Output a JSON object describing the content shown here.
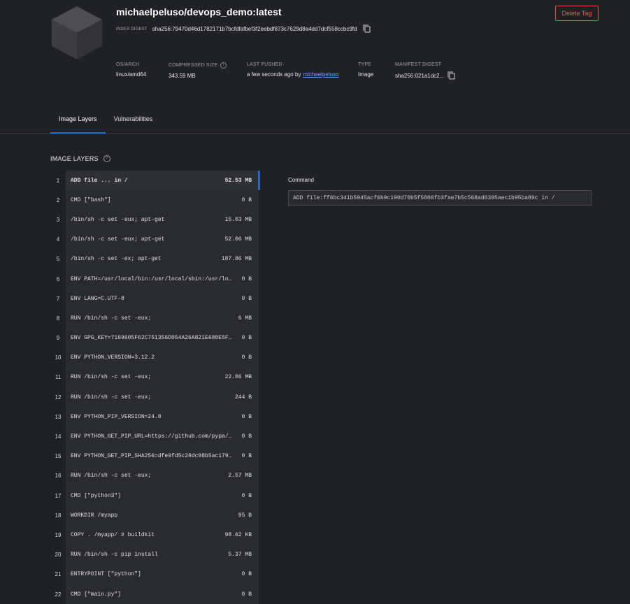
{
  "header": {
    "title": "michaelpeluso/devops_demo:latest",
    "index_digest_label": "INDEX DIGEST",
    "index_digest": "sha256:79470d46d1782171b7bcfdfafbef3f2eebdf873c7629d8a4dd7dcf558ccbc9fd",
    "delete_label": "Delete Tag"
  },
  "meta": {
    "os_arch_label": "OS/ARCH",
    "os_arch": "linux/amd64",
    "compressed_label": "COMPRESSED SIZE",
    "compressed": "343.59 MB",
    "pushed_label": "LAST PUSHED",
    "pushed_prefix": "a few seconds ago by",
    "pushed_user": "michaelpeluso",
    "type_label": "TYPE",
    "type": "Image",
    "manifest_label": "MANIFEST DIGEST",
    "manifest": "sha256:021a1dc2..."
  },
  "tabs": [
    {
      "label": "Image Layers",
      "active": true
    },
    {
      "label": "Vulnerabilities",
      "active": false
    }
  ],
  "section_title": "IMAGE LAYERS",
  "layers": [
    {
      "num": "1",
      "cmd": "ADD file ... in /",
      "size": "52.53 MB"
    },
    {
      "num": "2",
      "cmd": "CMD [\"bash\"]",
      "size": "0 B"
    },
    {
      "num": "3",
      "cmd": "/bin/sh -c set -eux; apt-get",
      "size": "15.03 MB"
    },
    {
      "num": "4",
      "cmd": "/bin/sh -c set -eux; apt-get",
      "size": "52.06 MB"
    },
    {
      "num": "5",
      "cmd": "/bin/sh -c set -ex; apt-get",
      "size": "187.86 MB"
    },
    {
      "num": "6",
      "cmd": "ENV PATH=/usr/local/bin:/usr/local/sbin:/usr/local/...",
      "size": "0 B"
    },
    {
      "num": "7",
      "cmd": "ENV LANG=C.UTF-8",
      "size": "0 B"
    },
    {
      "num": "8",
      "cmd": "RUN /bin/sh -c set -eux;",
      "size": "6 MB"
    },
    {
      "num": "9",
      "cmd": "ENV GPG_KEY=7169605F62C751356D054A26A821E680E5FA6305",
      "size": "0 B"
    },
    {
      "num": "10",
      "cmd": "ENV PYTHON_VERSION=3.12.2",
      "size": "0 B"
    },
    {
      "num": "11",
      "cmd": "RUN /bin/sh -c set -eux;",
      "size": "22.06 MB"
    },
    {
      "num": "12",
      "cmd": "RUN /bin/sh -c set -eux;",
      "size": "244 B"
    },
    {
      "num": "13",
      "cmd": "ENV PYTHON_PIP_VERSION=24.0",
      "size": "0 B"
    },
    {
      "num": "14",
      "cmd": "ENV PYTHON_GET_PIP_URL=https://github.com/pypa/get-...",
      "size": "0 B"
    },
    {
      "num": "15",
      "cmd": "ENV PYTHON_GET_PIP_SHA256=dfe9fd5c28dc98b5ac17979a9...",
      "size": "0 B"
    },
    {
      "num": "16",
      "cmd": "RUN /bin/sh -c set -eux;",
      "size": "2.57 MB"
    },
    {
      "num": "17",
      "cmd": "CMD [\"python3\"]",
      "size": "0 B"
    },
    {
      "num": "18",
      "cmd": "WORKDIR /myapp",
      "size": "95 B"
    },
    {
      "num": "19",
      "cmd": "COPY . /myapp/ # buildkit",
      "size": "98.62 KB"
    },
    {
      "num": "20",
      "cmd": "RUN /bin/sh -c pip install",
      "size": "5.37 MB"
    },
    {
      "num": "21",
      "cmd": "ENTRYPOINT [\"python\"]",
      "size": "0 B"
    },
    {
      "num": "22",
      "cmd": "CMD [\"main.py\"]",
      "size": "0 B"
    }
  ],
  "command_panel": {
    "label": "Command",
    "value": "ADD file:ff6bc341b5945acf6b9c190d70b5f5806fb3fae7b5c568ad6395aec1b95ba89c in /"
  },
  "colors": {
    "background": "#202124",
    "accent": "#1e6ad4",
    "danger": "#e25050",
    "link": "#6ba7ff"
  }
}
